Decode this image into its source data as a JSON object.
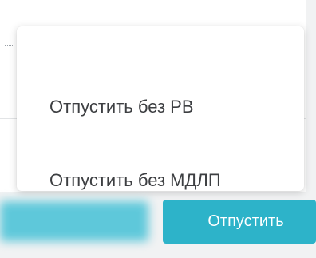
{
  "menu": {
    "items": [
      {
        "label": "Отпустить без РВ"
      },
      {
        "label": "Отпустить без МДЛП"
      }
    ]
  },
  "footer": {
    "primary_button_label": "Отпустить"
  },
  "colors": {
    "primary": "#2db3c9",
    "menu_text": "#3d3f42"
  }
}
